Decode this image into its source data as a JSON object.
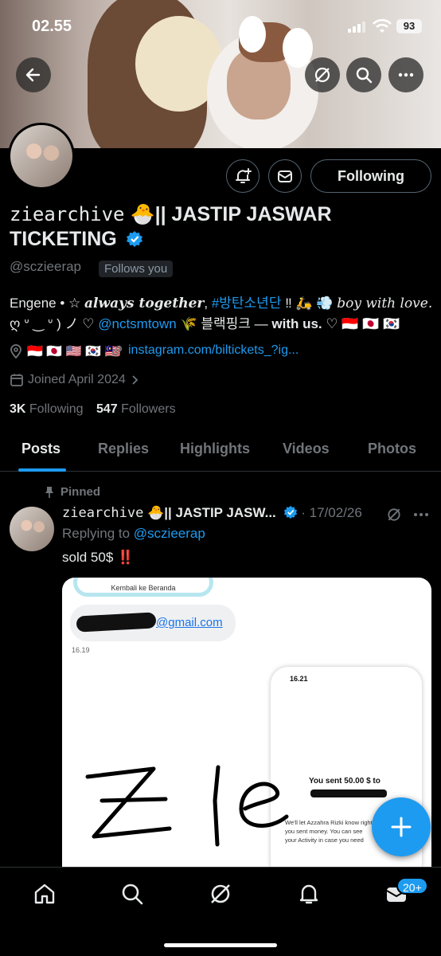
{
  "status_bar": {
    "time": "02.55",
    "battery": "93"
  },
  "header": {
    "back_icon": "arrow-left-icon",
    "grok_icon": "grok-icon",
    "search_icon": "search-icon",
    "more_icon": "more-icon"
  },
  "profile": {
    "name_mono": "ziearchive",
    "name_emoji": "🐣",
    "name_rest": "|| JASTIP JASWAR TICKETING",
    "handle": "@sczieerap",
    "follows_you": "Follows you",
    "following_button": "Following",
    "bio_line1_a": "Engene • ☆ ",
    "bio_line1_b": "always together",
    "bio_line1_c": ", ",
    "bio_hashtag": "#방탄소년단",
    "bio_line1_d": " ‼ 🛵 💨 ",
    "bio_line1_e": "boy with love.",
    "bio_line2_a": "ღ ᐡ ‿ ᐡ ) ノ ♡ ",
    "bio_mention": "@nctsmtown",
    "bio_line2_b": " 🌾 블랙핑크 — ",
    "bio_line2_c": "with us.",
    "bio_line2_d": " ♡ 🇮🇩 🇯🇵 🇰🇷",
    "location": "🇮🇩 🇯🇵 🇺🇸 🇰🇷 🇲🇾",
    "website": "instagram.com/biltickets_?ig...",
    "joined": "Joined April 2024",
    "following_count": "3K",
    "following_label": "Following",
    "followers_count": "547",
    "followers_label": "Followers"
  },
  "tabs": [
    "Posts",
    "Replies",
    "Highlights",
    "Videos",
    "Photos"
  ],
  "post": {
    "pinned_label": "Pinned",
    "author_mono": "ziearchive",
    "author_emoji": "🐣",
    "author_rest": "|| JASTIP JASW...",
    "date": "· 17/02/26",
    "replying_prefix": "Replying to ",
    "replying_handle": "@sczieerap",
    "text": "sold 50$ ",
    "text_emoji": "‼️"
  },
  "media": {
    "back_button": "Kembali ke Beranda",
    "email": "@gmail.com",
    "time_left": "16.19",
    "phone_time": "16.21",
    "sent_text": "You sent 50.00 $ to",
    "small_text_1": "We'll let Azzahra Rizki know right",
    "small_text_2": "you sent money. You can see",
    "small_text_3": "your Activity in case you need",
    "handwriting": "Z le"
  },
  "bottom_nav": {
    "badge": "20+"
  }
}
